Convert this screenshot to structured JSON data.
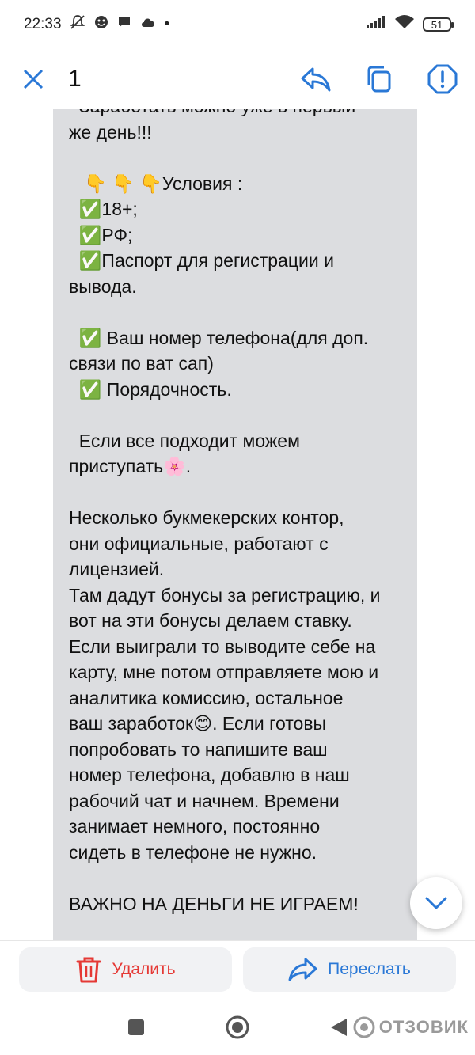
{
  "status_bar": {
    "time": "22:33",
    "battery": "51",
    "dot": "•"
  },
  "app_bar": {
    "counter": "1"
  },
  "message": {
    "text": "  Заработать можно уже в первый\nже день!!!\n\n   👇 👇 👇Условия :\n  ✅18+;\n  ✅РФ;\n  ✅Паспорт для регистрации и\nвывода.\n\n  ✅ Ваш номер телефона(для доп.\nсвязи по ват сап)\n  ✅ Порядочность.\n\n  Если все подходит можем\nприступать🌸.\n\nНесколько букмекерских контор,\nони официальные, работают с\nлицензией.\nТам дадут бонусы за регистрацию, и\nвот на эти бонусы делаем ставку.\nЕсли выиграли то выводите себе на\nкарту, мне потом отправляете мою и\nаналитика комиссию, остальное\nваш заработок😊. Если готовы\nпопробовать то напишите ваш\nномер телефона, добавлю в наш\nрабочий чат и начнем. Времени\nзанимает немного, постоянно\nсидеть в телефоне не нужно.\n\nВАЖНО НА ДЕНЬГИ НЕ ИГРАЕМ!"
  },
  "bottom_actions": {
    "delete_label": "Удалить",
    "forward_label": "Переслать"
  },
  "watermark": {
    "text": "ОТЗОВИК"
  },
  "colors": {
    "accent": "#2a78d6",
    "danger": "#e53935",
    "bubble": "#dcdde0"
  }
}
